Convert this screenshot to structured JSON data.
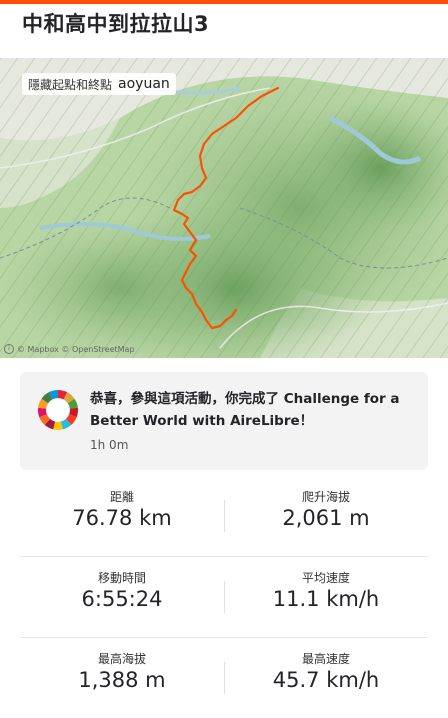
{
  "activity": {
    "title": "中和高中到拉拉山3"
  },
  "map": {
    "hide_points_label": "隱藏起點和終點",
    "athlete": "aoyuan",
    "attribution": "© Mapbox © OpenStreetMap",
    "route_color": "#fc5200"
  },
  "challenge": {
    "message": "恭喜，參與這項活動，你完成了 Challenge for a Better World with AireLibre！",
    "duration": "1h 0m",
    "badge_icon": "sdg-wheel-icon"
  },
  "stats": [
    {
      "label": "距離",
      "value": "76.78 km"
    },
    {
      "label": "爬升海拔",
      "value": "2,061 m"
    },
    {
      "label": "移動時間",
      "value": "6:55:24"
    },
    {
      "label": "平均速度",
      "value": "11.1 km/h"
    },
    {
      "label": "最高海拔",
      "value": "1,388 m"
    },
    {
      "label": "最高速度",
      "value": "45.7 km/h"
    }
  ],
  "colors": {
    "accent": "#fc5200",
    "text": "#242428",
    "card": "#f3f3f3"
  }
}
